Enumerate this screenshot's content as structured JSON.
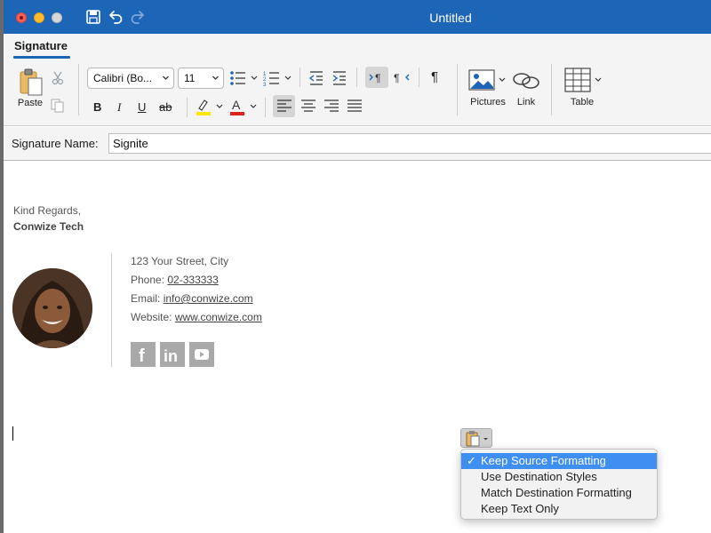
{
  "window": {
    "title": "Untitled"
  },
  "ribbon": {
    "tab": "Signature",
    "paste_label": "Paste",
    "font_name": "Calibri (Bo...",
    "font_size": "11",
    "pictures_label": "Pictures",
    "link_label": "Link",
    "table_label": "Table",
    "bold": "B",
    "italic": "I",
    "underline": "U",
    "strike": "ab",
    "pilcrow": "¶"
  },
  "signature_name": {
    "label": "Signature Name:",
    "value": "Signite"
  },
  "body": {
    "greeting": "Kind Regards,",
    "company": "Conwize Tech",
    "address": "123 Your Street, City",
    "phone_label": "Phone: ",
    "phone": "02-333333",
    "email_label": "Email: ",
    "email": "info@conwize.com",
    "website_label": "Website: ",
    "website": "www.conwize.com",
    "social": [
      {
        "icon": "facebook-icon",
        "glyph": "f"
      },
      {
        "icon": "linkedin-icon",
        "glyph": "in"
      },
      {
        "icon": "youtube-icon",
        "glyph": "▶"
      }
    ]
  },
  "paste_options": {
    "items": [
      {
        "label": "Keep Source Formatting",
        "selected": true
      },
      {
        "label": "Use Destination Styles",
        "selected": false
      },
      {
        "label": "Match Destination Formatting",
        "selected": false
      },
      {
        "label": "Keep Text Only",
        "selected": false
      }
    ]
  },
  "colors": {
    "accent": "#1d65b6",
    "highlight": "#ffe800",
    "font_color": "#e0221b",
    "menu_selected": "#3f8ff0"
  }
}
